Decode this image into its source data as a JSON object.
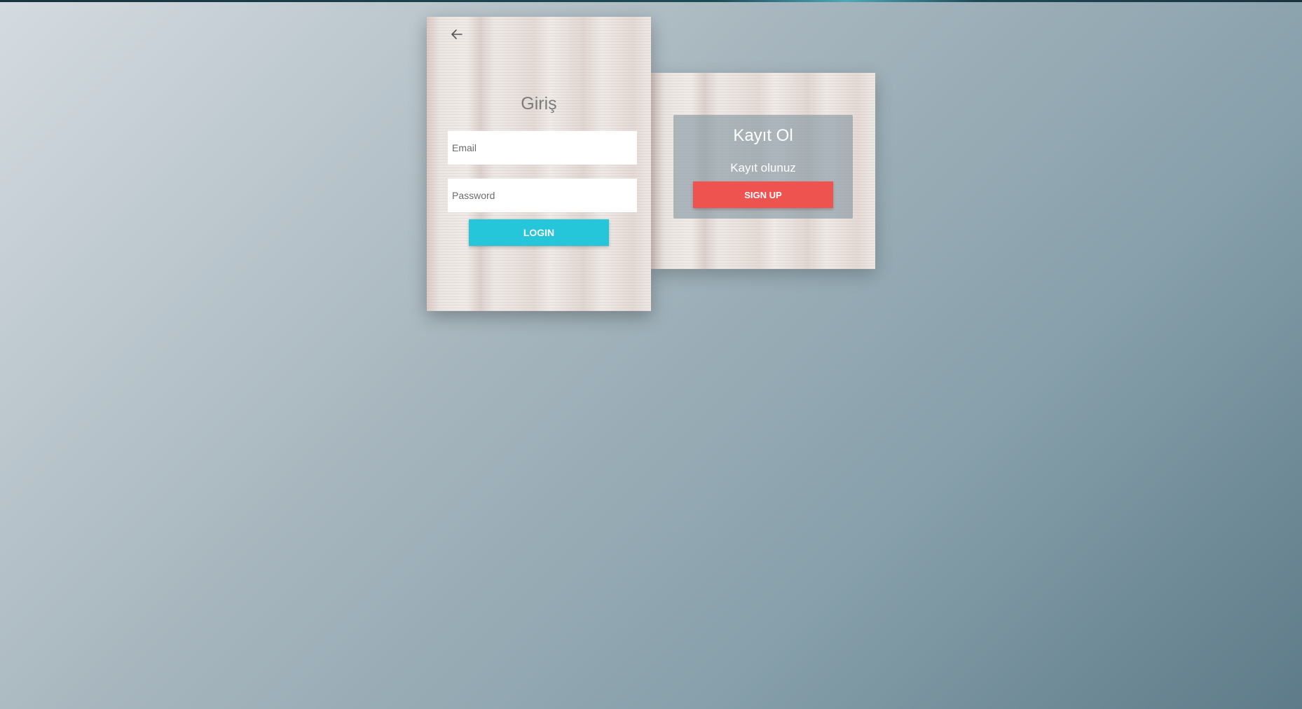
{
  "login": {
    "back_icon": "arrow-left-icon",
    "title": "Giriş",
    "email_placeholder": "Email",
    "password_placeholder": "Password",
    "login_label": "LOGIN"
  },
  "register": {
    "title": "Kayıt Ol",
    "subtitle": "Kayıt olunuz",
    "signup_label": "SIGN UP"
  },
  "colors": {
    "login_button": "#26c6da",
    "signup_button": "#ef5350"
  }
}
